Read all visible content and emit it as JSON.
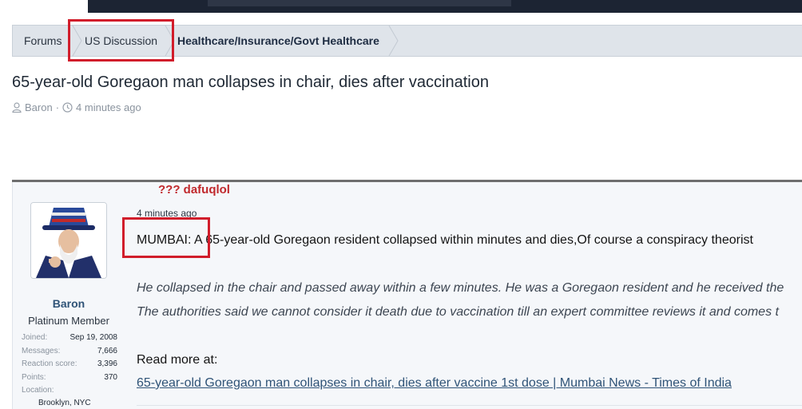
{
  "breadcrumb": {
    "items": [
      {
        "label": "Forums"
      },
      {
        "label": "US Discussion"
      },
      {
        "label": "Healthcare/Insurance/Govt Healthcare"
      }
    ]
  },
  "thread": {
    "title": "65-year-old Goregaon man collapses in chair, dies after vaccination",
    "author": "Baron",
    "separator": "·",
    "time": "4 minutes ago"
  },
  "annotation": "??? dafuqlol",
  "user": {
    "name": "Baron",
    "title": "Platinum Member",
    "stats": [
      {
        "label": "Joined:",
        "value": "Sep 19, 2008"
      },
      {
        "label": "Messages:",
        "value": "7,666"
      },
      {
        "label": "Reaction score:",
        "value": "3,396"
      },
      {
        "label": "Points:",
        "value": "370"
      },
      {
        "label": "Location:",
        "value": ""
      }
    ],
    "location": "Brooklyn, NYC"
  },
  "post": {
    "time": "4 minutes ago",
    "line1": "MUMBAI: A 65-year-old Goregaon resident collapsed within minutes and dies,Of course a conspiracy theorist",
    "quote1": "He collapsed in the chair and passed away within a few minutes. He was a Goregaon resident and he received the",
    "quote2": "The authorities said we cannot consider it death due to vaccination till an expert committee reviews it and comes t",
    "read_more": "Read more at:",
    "link_text": "65-year-old Goregaon man collapses in chair, dies after vaccine 1st dose | Mumbai News - Times of India"
  },
  "colors": {
    "highlight_box": "#d11d2b",
    "link": "#2f5377",
    "breadcrumb_bg": "#dfe4ea"
  }
}
